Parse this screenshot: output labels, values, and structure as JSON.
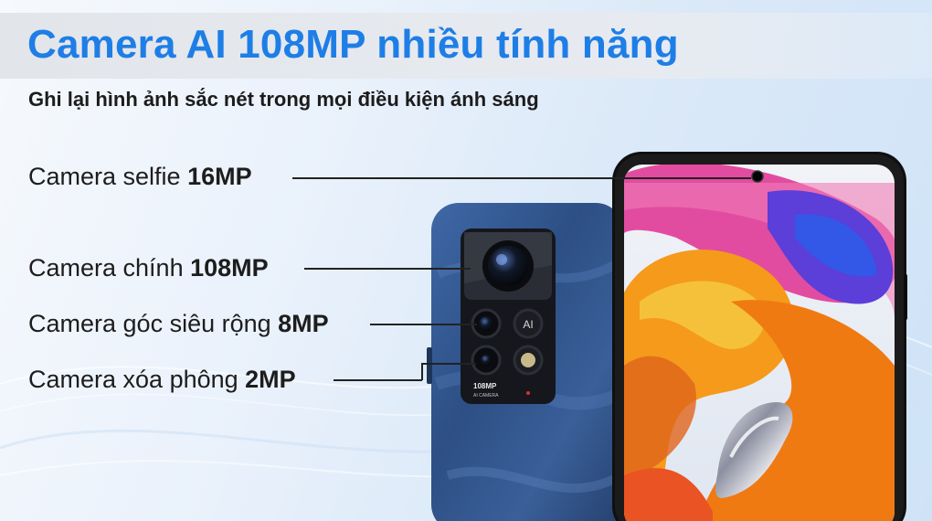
{
  "header": {
    "title": "Camera AI 108MP nhiều tính năng",
    "subtitle": "Ghi lại hình ảnh sắc nét trong mọi điều kiện ánh sáng"
  },
  "features": [
    {
      "label": "Camera selfie ",
      "value": "16MP"
    },
    {
      "label": "Camera chính ",
      "value": "108MP"
    },
    {
      "label": "Camera góc siêu rộng ",
      "value": "8MP"
    },
    {
      "label": "Camera xóa phông ",
      "value": "2MP"
    }
  ],
  "camera_module": {
    "text_main": "108MP",
    "text_sub": "AI CAMERA",
    "ai_badge": "AI"
  },
  "colors": {
    "title": "#1e7ee6",
    "phone_back": "#2c4a7a",
    "phone_frame": "#111111"
  }
}
